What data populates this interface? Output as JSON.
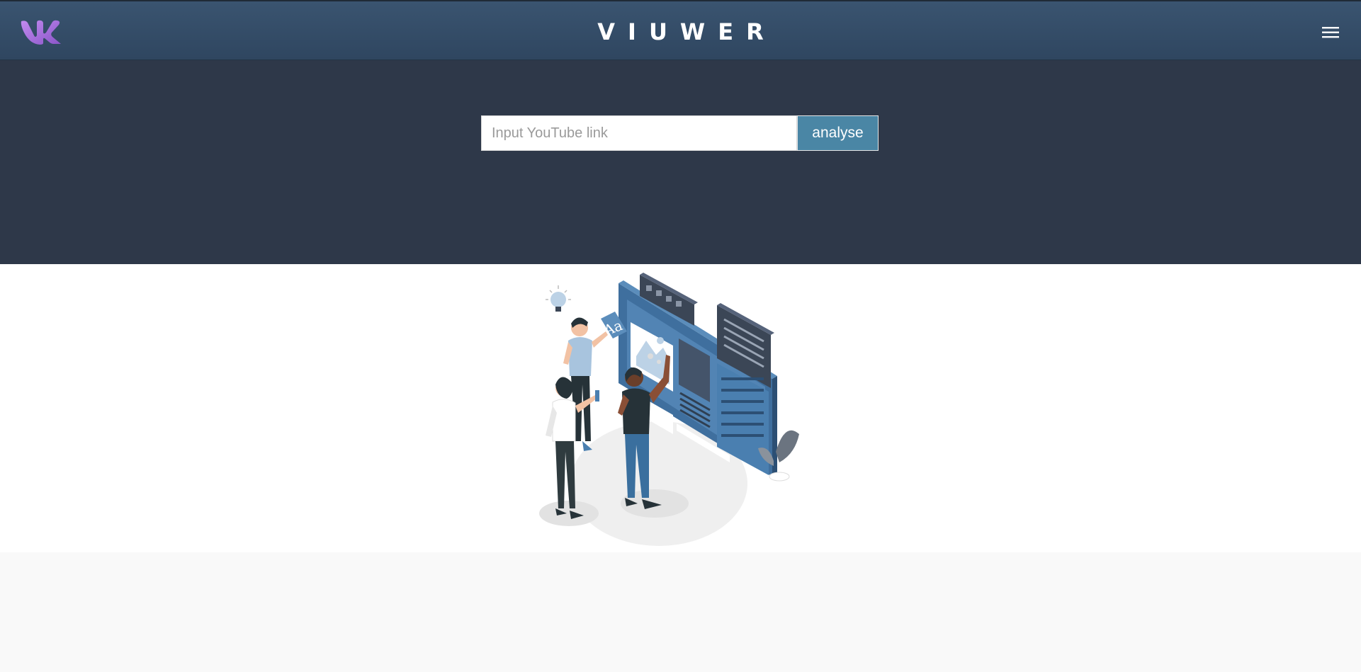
{
  "header": {
    "brand": "VIUWER",
    "logo_icon": "vk-logo-icon",
    "menu_icon": "hamburger-menu-icon"
  },
  "search": {
    "placeholder": "Input YouTube link",
    "value": "",
    "button_label": "analyse"
  },
  "illustration": {
    "icon": "web-design-team-illustration"
  },
  "colors": {
    "navbar": "#34495e",
    "hero": "#2e3849",
    "button": "#4a86a5",
    "logo": "#a26ad8",
    "accent_blue": "#4a7fb0"
  }
}
